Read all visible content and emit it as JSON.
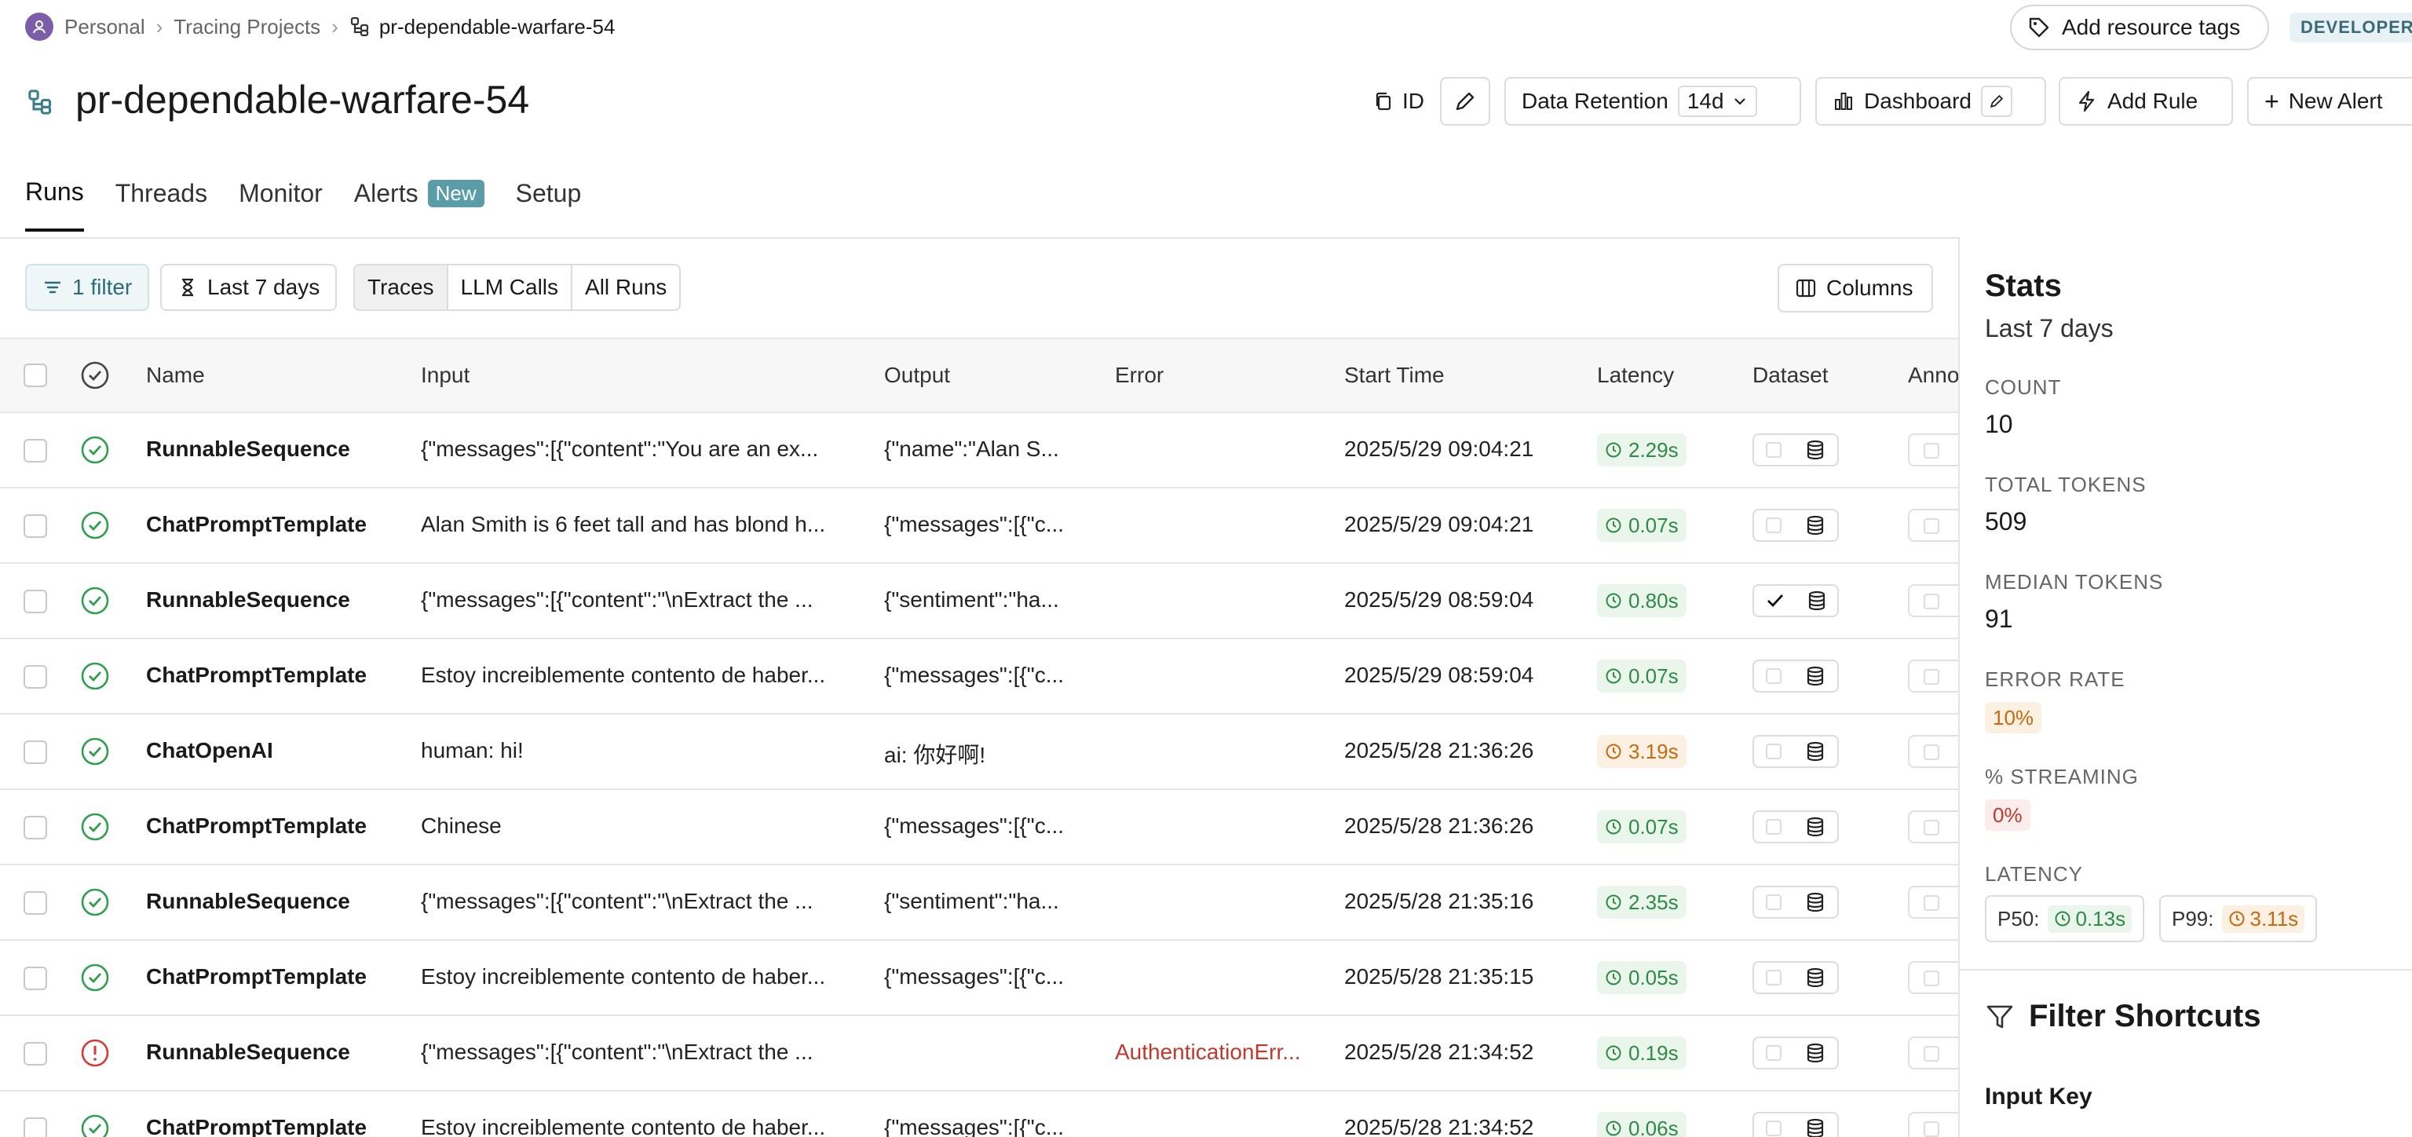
{
  "breadcrumb": {
    "workspace": "Personal",
    "section": "Tracing Projects",
    "project": "pr-dependable-warfare-54"
  },
  "header": {
    "add_tags": "Add resource tags",
    "badge": "DEVELOPER",
    "title": "pr-dependable-warfare-54",
    "id_label": "ID",
    "retention_label": "Data Retention",
    "retention_value": "14d",
    "dashboard": "Dashboard",
    "add_rule": "Add Rule",
    "new_alert": "New Alert"
  },
  "tabs": [
    {
      "label": "Runs"
    },
    {
      "label": "Threads"
    },
    {
      "label": "Monitor"
    },
    {
      "label": "Alerts",
      "badge": "New"
    },
    {
      "label": "Setup"
    }
  ],
  "filters": {
    "filter": "1 filter",
    "time": "Last 7 days",
    "segments": [
      "Traces",
      "LLM Calls",
      "All Runs"
    ],
    "columns": "Columns"
  },
  "table": {
    "headers": [
      "Name",
      "Input",
      "Output",
      "Error",
      "Start Time",
      "Latency",
      "Dataset",
      "Anno"
    ],
    "rows": [
      {
        "status": "success",
        "name": "RunnableSequence",
        "input": "{\"messages\":[{\"content\":\"You are an ex...",
        "output": "{\"name\":\"Alan S...",
        "error": "",
        "time": "2025/5/29 09:04:21",
        "latency": "2.29s",
        "lat_level": "green",
        "dataset_checked": false
      },
      {
        "status": "success",
        "name": "ChatPromptTemplate",
        "input": "Alan Smith is 6 feet tall and has blond h...",
        "output": "{\"messages\":[{\"c...",
        "error": "",
        "time": "2025/5/29 09:04:21",
        "latency": "0.07s",
        "lat_level": "green",
        "dataset_checked": false
      },
      {
        "status": "success",
        "name": "RunnableSequence",
        "input": "{\"messages\":[{\"content\":\"\\nExtract the ...",
        "output": "{\"sentiment\":\"ha...",
        "error": "",
        "time": "2025/5/29 08:59:04",
        "latency": "0.80s",
        "lat_level": "green",
        "dataset_checked": true
      },
      {
        "status": "success",
        "name": "ChatPromptTemplate",
        "input": "Estoy increiblemente contento de haber...",
        "output": "{\"messages\":[{\"c...",
        "error": "",
        "time": "2025/5/29 08:59:04",
        "latency": "0.07s",
        "lat_level": "green",
        "dataset_checked": false
      },
      {
        "status": "success",
        "name": "ChatOpenAI",
        "input": "human: hi!",
        "output": "ai: 你好啊!",
        "error": "",
        "time": "2025/5/28 21:36:26",
        "latency": "3.19s",
        "lat_level": "orange",
        "dataset_checked": false
      },
      {
        "status": "success",
        "name": "ChatPromptTemplate",
        "input": "Chinese",
        "output": "{\"messages\":[{\"c...",
        "error": "",
        "time": "2025/5/28 21:36:26",
        "latency": "0.07s",
        "lat_level": "green",
        "dataset_checked": false
      },
      {
        "status": "success",
        "name": "RunnableSequence",
        "input": "{\"messages\":[{\"content\":\"\\nExtract the ...",
        "output": "{\"sentiment\":\"ha...",
        "error": "",
        "time": "2025/5/28 21:35:16",
        "latency": "2.35s",
        "lat_level": "green",
        "dataset_checked": false
      },
      {
        "status": "success",
        "name": "ChatPromptTemplate",
        "input": "Estoy increiblemente contento de haber...",
        "output": "{\"messages\":[{\"c...",
        "error": "",
        "time": "2025/5/28 21:35:15",
        "latency": "0.05s",
        "lat_level": "green",
        "dataset_checked": false
      },
      {
        "status": "error",
        "name": "RunnableSequence",
        "input": "{\"messages\":[{\"content\":\"\\nExtract the ...",
        "output": "",
        "error": "AuthenticationErr...",
        "time": "2025/5/28 21:34:52",
        "latency": "0.19s",
        "lat_level": "green",
        "dataset_checked": false
      },
      {
        "status": "success",
        "name": "ChatPromptTemplate",
        "input": "Estoy increiblemente contento de haber...",
        "output": "{\"messages\":[{\"c...",
        "error": "",
        "time": "2025/5/28 21:34:52",
        "latency": "0.06s",
        "lat_level": "green",
        "dataset_checked": false
      }
    ]
  },
  "stats": {
    "title": "Stats",
    "period": "Last 7 days",
    "count_label": "COUNT",
    "count": "10",
    "tokens_label": "TOTAL TOKENS",
    "tokens": "509",
    "median_label": "MEDIAN TOKENS",
    "median": "91",
    "error_rate_label": "ERROR RATE",
    "error_rate": "10%",
    "streaming_label": "% STREAMING",
    "streaming": "0%",
    "latency_label": "LATENCY",
    "p50_label": "P50:",
    "p50": "0.13s",
    "p99_label": "P99:",
    "p99": "3.11s",
    "filter_shortcuts": "Filter Shortcuts",
    "input_key": "Input Key"
  },
  "colors": {
    "success": "#2e9e4f",
    "error": "#d93838",
    "accent": "#5a9ca8"
  }
}
